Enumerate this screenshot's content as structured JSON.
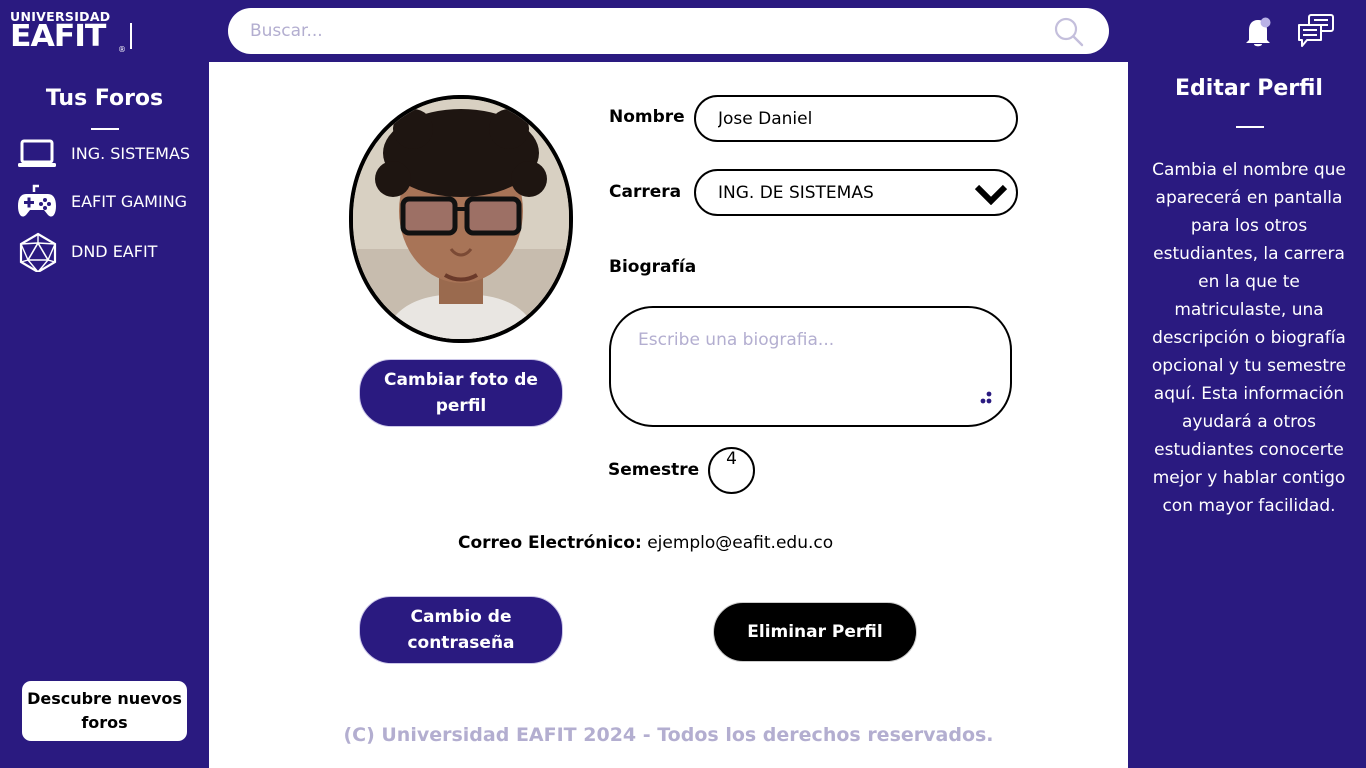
{
  "header": {
    "logo_top": "UNIVERSIDAD",
    "logo_main": "EAFIT",
    "logo_reg": "®",
    "search_placeholder": "Buscar..."
  },
  "sidebar": {
    "title": "Tus Foros",
    "forums": [
      {
        "label": "ING. SISTEMAS",
        "icon": "laptop-icon"
      },
      {
        "label": "EAFIT GAMING",
        "icon": "gamepad-icon"
      },
      {
        "label": "DND EAFIT",
        "icon": "d20-icon"
      }
    ],
    "discover_label": "Descubre nuevos foros"
  },
  "profile": {
    "change_photo_label": "Cambiar foto de perfil",
    "name_label": "Nombre",
    "name_value": "Jose Daniel",
    "career_label": "Carrera",
    "career_value": "ING. DE SISTEMAS",
    "bio_label": "Biografía",
    "bio_placeholder": "Escribe una biografia...",
    "semester_label": "Semestre",
    "semester_value": "4",
    "email_label": "Correo Electrónico:",
    "email_value": "ejemplo@eafit.edu.co",
    "change_password_label": "Cambio de contraseña",
    "delete_label": "Eliminar Perfil"
  },
  "footer": {
    "text": "(C) Universidad EAFIT 2024 - Todos los derechos reservados."
  },
  "help_panel": {
    "title": "Editar Perfil",
    "description": "Cambia el nombre que aparecerá en pantalla para los otros estudiantes, la carrera en la que te matriculaste, una descripción o biografía opcional y tu semestre aquí. Esta información ayudará a otros estudiantes conocerte mejor y hablar contigo con mayor facilidad."
  },
  "colors": {
    "brand": "#2a1a80",
    "accent_light": "#b3aed0",
    "surface": "#ffffff",
    "danger_button": "#000000"
  }
}
